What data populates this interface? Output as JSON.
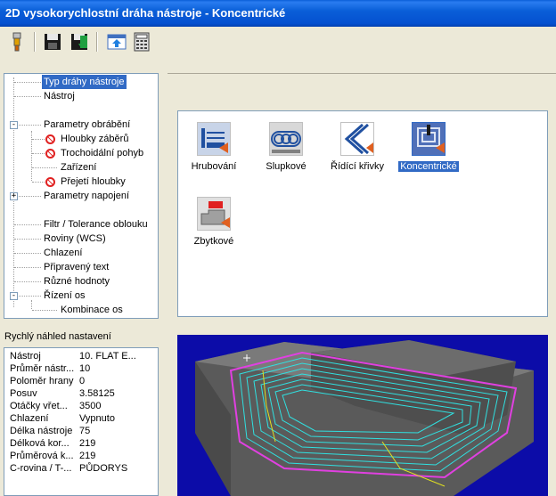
{
  "window": {
    "title": "2D vysokorychlostní dráha nástroje - Koncentrické"
  },
  "toolbar": {
    "buttons": [
      {
        "icon": "tool-icon"
      },
      {
        "icon": "save-icon"
      },
      {
        "icon": "save-green-icon"
      },
      {
        "icon": "export-icon"
      },
      {
        "icon": "calculator-icon"
      }
    ]
  },
  "tree": {
    "items": [
      {
        "label": "Typ dráhy nástroje",
        "selected": true
      },
      {
        "label": "Nástroj"
      },
      {
        "label": "Parametry obrábění",
        "expander": "-"
      },
      {
        "label": "Hloubky záběrů",
        "disabled_icon": true
      },
      {
        "label": "Trochoidální pohyb",
        "disabled_icon": true
      },
      {
        "label": "Zařízení"
      },
      {
        "label": "Přejetí hloubky",
        "disabled_icon": true
      },
      {
        "label": "Parametry napojení",
        "expander": "+"
      },
      {
        "label": "Filtr / Tolerance oblouku"
      },
      {
        "label": "Roviny (WCS)"
      },
      {
        "label": "Chlazení"
      },
      {
        "label": "Připravený text"
      },
      {
        "label": "Různé hodnoty"
      },
      {
        "label": "Řízení os",
        "expander": "-"
      },
      {
        "label": "Kombinace os"
      }
    ]
  },
  "preview": {
    "heading": "Rychlý náhled nastavení",
    "rows": [
      {
        "key": "Nástroj",
        "value": "10. FLAT E..."
      },
      {
        "key": "Průměr nástr...",
        "value": "10"
      },
      {
        "key": "Poloměr hrany",
        "value": "0"
      },
      {
        "key": "Posuv",
        "value": "3.58125"
      },
      {
        "key": "Otáčky vřet...",
        "value": "3500"
      },
      {
        "key": "Chlazení",
        "value": "Vypnuto"
      },
      {
        "key": "Délka nástroje",
        "value": "75"
      },
      {
        "key": "Délková kor...",
        "value": "219"
      },
      {
        "key": "Průměrová k...",
        "value": "219"
      },
      {
        "key": "C-rovina / T-...",
        "value": "PŮDORYS"
      }
    ]
  },
  "toolpath_types": [
    {
      "label": "Hrubování",
      "icon": "roughing-icon"
    },
    {
      "label": "Slupkové",
      "icon": "core-mill-icon"
    },
    {
      "label": "Řídící křivky",
      "icon": "rest-curves-icon"
    },
    {
      "label": "Koncentrické",
      "icon": "concentric-icon",
      "selected": true
    },
    {
      "label": "Zbytkové",
      "icon": "rest-mill-icon"
    }
  ],
  "colors": {
    "titlebar": "#0a5fd8",
    "selection": "#316ac5",
    "viewport_bg": "#0c0ca8",
    "toolpath": "#30e0e0",
    "boundary": "#e040e0",
    "part": "#6e6e6e"
  }
}
